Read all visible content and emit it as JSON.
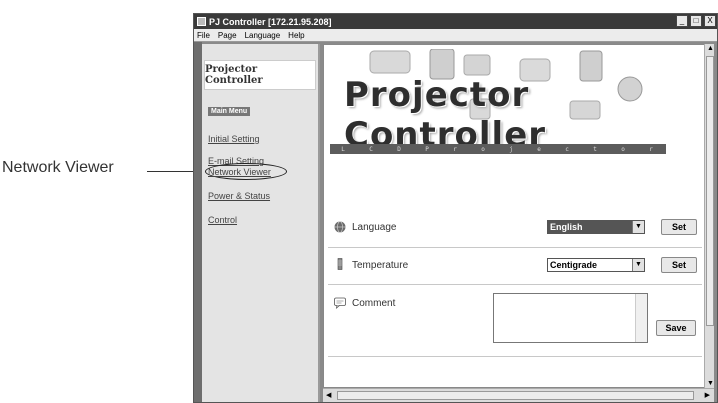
{
  "callout": {
    "label": "Network Viewer"
  },
  "window": {
    "title": "PJ Controller [172.21.95.208]",
    "controls": [
      "_",
      "□",
      "X"
    ]
  },
  "menubar": {
    "items": [
      "File",
      "Page",
      "Language",
      "Help"
    ]
  },
  "sidebar": {
    "logo_text": "Projector Controller",
    "badge": "Main Menu",
    "items": [
      {
        "label": "Initial Setting"
      },
      {
        "label": "E-mail Setting"
      },
      {
        "label": "Network Viewer"
      },
      {
        "label": "Power & Status"
      },
      {
        "label": "Control"
      }
    ]
  },
  "main": {
    "banner_title": "Projector Controller",
    "lcd_strip": [
      "L",
      "C",
      "D",
      "P",
      "r",
      "o",
      "j",
      "e",
      "c",
      "t",
      "o",
      "r"
    ],
    "rows": {
      "language": {
        "label": "Language",
        "value": "English",
        "button": "Set",
        "icon": "globe-icon"
      },
      "temperature": {
        "label": "Temperature",
        "value": "Centigrade",
        "button": "Set",
        "icon": "thermometer-icon"
      },
      "comment": {
        "label": "Comment",
        "value": "",
        "button": "Save",
        "icon": "speech-bubble-icon"
      }
    }
  },
  "colors": {
    "titlebar": "#3a3a3a",
    "lcd_strip": "#5c5c5c",
    "selected_dropdown": "#555555"
  }
}
